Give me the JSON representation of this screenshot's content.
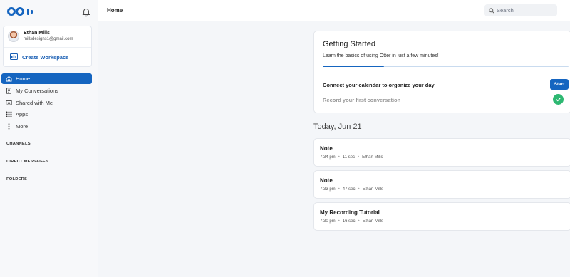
{
  "sidebar": {
    "user": {
      "name": "Ethan Mills",
      "email": "millsdesigns1@gmail.com"
    },
    "create_workspace": "Create Workspace",
    "nav": [
      {
        "label": "Home",
        "icon": "home-icon"
      },
      {
        "label": "My Conversations",
        "icon": "document-icon"
      },
      {
        "label": "Shared with Me",
        "icon": "shared-icon"
      },
      {
        "label": "Apps",
        "icon": "apps-grid-icon"
      },
      {
        "label": "More",
        "icon": "more-vertical-icon"
      }
    ],
    "sections": {
      "channels": "CHANNELS",
      "direct_messages": "DIRECT MESSAGES",
      "folders": "FOLDERS"
    }
  },
  "header": {
    "title": "Home",
    "search_placeholder": "Search"
  },
  "getting_started": {
    "title": "Getting Started",
    "subtitle": "Learn the basics of using Otter in just a few minutes!",
    "progress": 0.25,
    "task1": "Connect your calendar to organize your day",
    "start_label": "Start",
    "task2": "Record your first conversation"
  },
  "date_heading": "Today, Jun 21",
  "notes": [
    {
      "title": "Note",
      "time": "7:34 pm",
      "duration": "11 sec",
      "author": "Ethan Mills"
    },
    {
      "title": "Note",
      "time": "7:33 pm",
      "duration": "47 sec",
      "author": "Ethan Mills"
    },
    {
      "title": "My Recording Tutorial",
      "time": "7:30 pm",
      "duration": "16 sec",
      "author": "Ethan Mills"
    }
  ],
  "colors": {
    "accent": "#1565c0",
    "success": "#2eb872"
  }
}
